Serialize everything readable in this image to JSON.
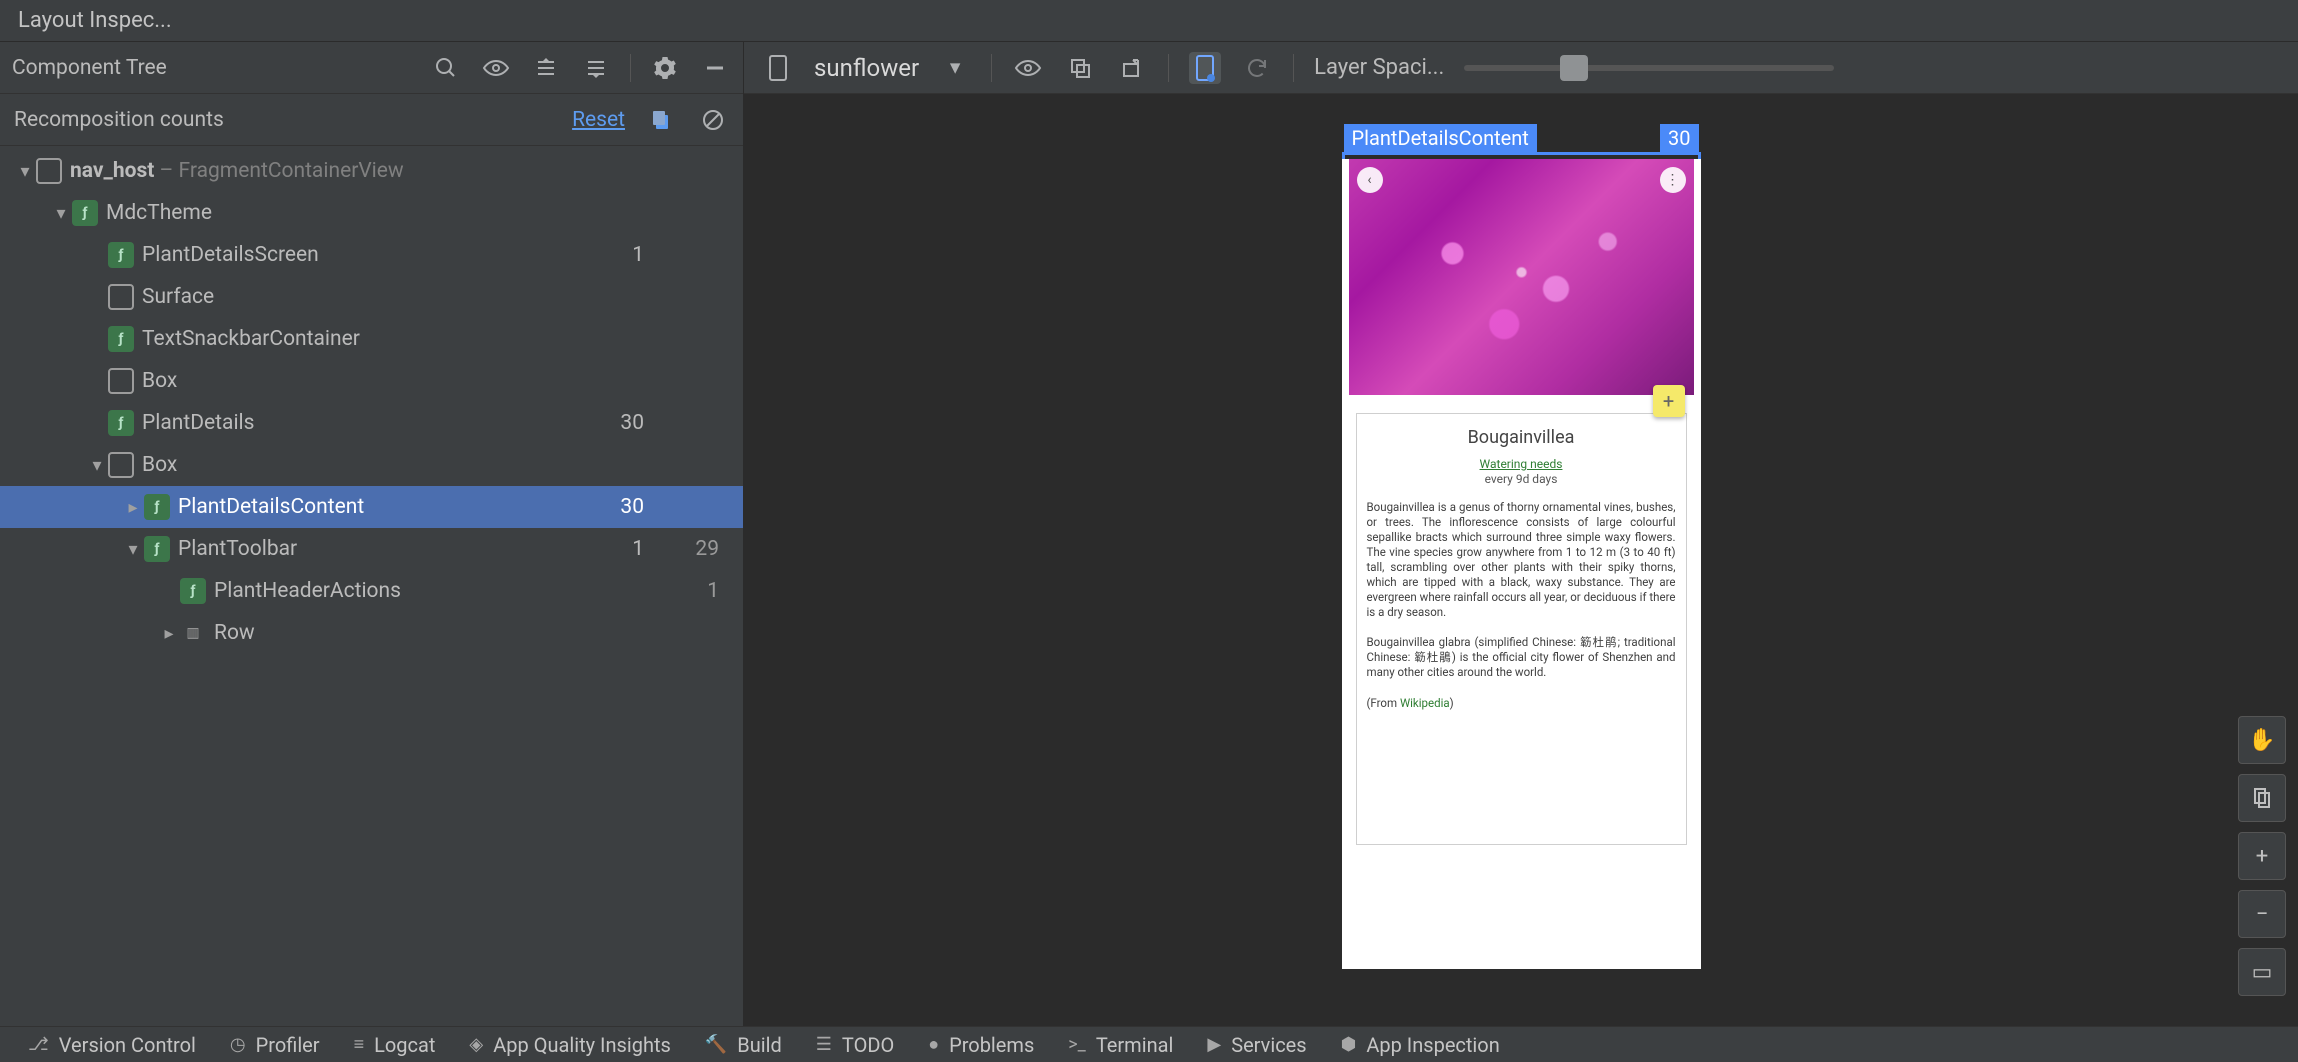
{
  "window": {
    "title": "Layout Inspec..."
  },
  "componentTree": {
    "title": "Component Tree",
    "recompLabel": "Recomposition counts",
    "resetLabel": "Reset",
    "rows": [
      {
        "indent": 0,
        "chev": "▾",
        "icon": "view",
        "label": "nav_host",
        "suffix": " – FragmentContainerView",
        "c1": "",
        "c2": "",
        "bold": true
      },
      {
        "indent": 1,
        "chev": "▾",
        "icon": "compose",
        "label": "MdcTheme",
        "c1": "",
        "c2": ""
      },
      {
        "indent": 2,
        "chev": "",
        "icon": "compose",
        "label": "PlantDetailsScreen",
        "c1": "1",
        "c2": ""
      },
      {
        "indent": 2,
        "chev": "",
        "icon": "view",
        "label": "Surface",
        "c1": "",
        "c2": ""
      },
      {
        "indent": 2,
        "chev": "",
        "icon": "compose",
        "label": "TextSnackbarContainer",
        "c1": "",
        "c2": ""
      },
      {
        "indent": 2,
        "chev": "",
        "icon": "view",
        "label": "Box",
        "c1": "",
        "c2": ""
      },
      {
        "indent": 2,
        "chev": "",
        "icon": "compose",
        "label": "PlantDetails",
        "c1": "30",
        "c2": ""
      },
      {
        "indent": 2,
        "chev": "▾",
        "icon": "view",
        "label": "Box",
        "c1": "",
        "c2": ""
      },
      {
        "indent": 3,
        "chev": "▸",
        "icon": "compose",
        "label": "PlantDetailsContent",
        "c1": "30",
        "c2": "",
        "selected": true
      },
      {
        "indent": 3,
        "chev": "▾",
        "icon": "compose",
        "label": "PlantToolbar",
        "c1": "1",
        "c2": "29"
      },
      {
        "indent": 4,
        "chev": "",
        "icon": "compose",
        "label": "PlantHeaderActions",
        "c1": "",
        "c2": "1"
      },
      {
        "indent": 4,
        "chev": "▸",
        "icon": "column",
        "label": "Row",
        "c1": "",
        "c2": ""
      }
    ]
  },
  "preview": {
    "process": "sunflower",
    "sliderLabel": "Layer Spaci...",
    "selection": {
      "label": "PlantDetailsContent",
      "count": "30"
    },
    "plant": {
      "title": "Bougainvillea",
      "wateringLabel": "Watering needs",
      "wateringValue": "every 9d days",
      "desc1": "Bougainvillea is a genus of thorny ornamental vines, bushes, or trees. The inflorescence consists of large colourful sepallike bracts which surround three simple waxy flowers. The vine species grow anywhere from 1 to 12 m (3 to 40 ft) tall, scrambling over other plants with their spiky thorns, which are tipped with a black, waxy substance. They are evergreen where rainfall occurs all year, or deciduous if there is a dry season.",
      "desc2": "Bougainvillea glabra (simplified Chinese: 簕杜鹃; traditional Chinese: 簕杜鵑) is the official city flower of Shenzhen and many other cities around the world.",
      "fromLabel": "(From ",
      "wikiLabel": "Wikipedia",
      "fromClose": ")"
    }
  },
  "bottomTabs": [
    {
      "icon": "branch",
      "label": "Version Control"
    },
    {
      "icon": "gauge",
      "label": "Profiler"
    },
    {
      "icon": "logcat",
      "label": "Logcat"
    },
    {
      "icon": "diamond",
      "label": "App Quality Insights"
    },
    {
      "icon": "hammer",
      "label": "Build"
    },
    {
      "icon": "list",
      "label": "TODO"
    },
    {
      "icon": "warn",
      "label": "Problems"
    },
    {
      "icon": "terminal",
      "label": "Terminal"
    },
    {
      "icon": "play",
      "label": "Services"
    },
    {
      "icon": "bug",
      "label": "App Inspection"
    }
  ]
}
